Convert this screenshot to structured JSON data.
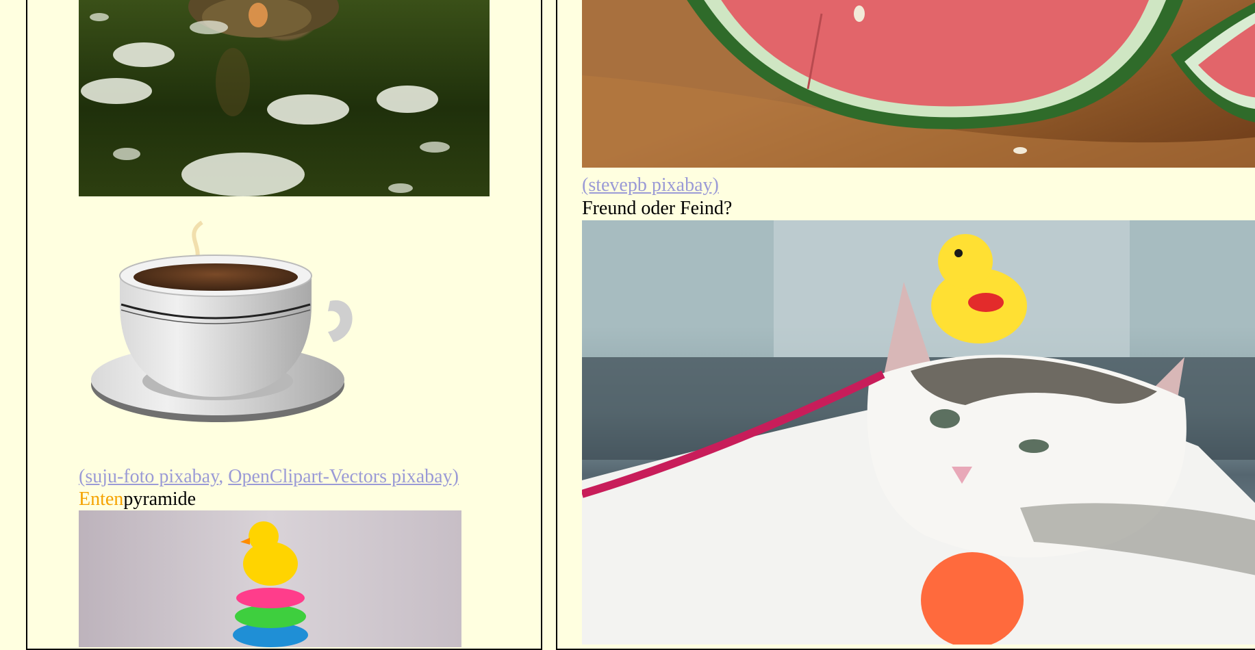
{
  "left_column": {
    "credits": {
      "link1": "(suju-foto pixabay",
      "separator": ",",
      "link2": "OpenClipart-Vectors pixabay)"
    },
    "caption": {
      "accent": "Enten",
      "rest": "pyramide"
    }
  },
  "right_column": {
    "credits": {
      "link1": "(stevepb pixabay)"
    },
    "caption": "Freund oder Feind?"
  },
  "colors": {
    "background": "#ffffe0",
    "link": "#9a9ad6",
    "accent": "#f5a200"
  }
}
